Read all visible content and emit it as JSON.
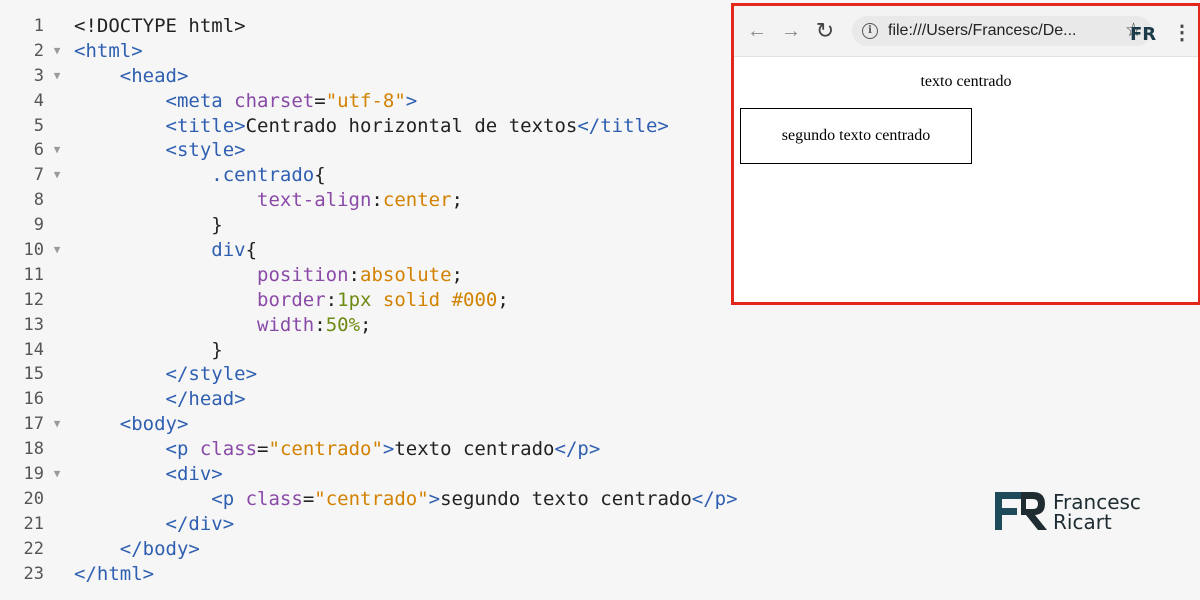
{
  "editor": {
    "lines": [
      {
        "n": "1",
        "fold": false,
        "indent": 0,
        "tokens": [
          [
            "p",
            "<!DOCTYPE html>"
          ]
        ]
      },
      {
        "n": "2",
        "fold": true,
        "indent": 0,
        "tokens": [
          [
            "t",
            "<html>"
          ]
        ]
      },
      {
        "n": "3",
        "fold": true,
        "indent": 4,
        "tokens": [
          [
            "t",
            "<head>"
          ]
        ]
      },
      {
        "n": "4",
        "fold": false,
        "indent": 8,
        "tokens": [
          [
            "t",
            "<meta "
          ],
          [
            "a",
            "charset"
          ],
          [
            "p",
            "="
          ],
          [
            "s",
            "\"utf-8\""
          ],
          [
            "t",
            ">"
          ]
        ]
      },
      {
        "n": "5",
        "fold": false,
        "indent": 8,
        "tokens": [
          [
            "t",
            "<title>"
          ],
          [
            "p",
            "Centrado horizontal de textos"
          ],
          [
            "t",
            "</title>"
          ]
        ]
      },
      {
        "n": "6",
        "fold": true,
        "indent": 8,
        "tokens": [
          [
            "t",
            "<style>"
          ]
        ]
      },
      {
        "n": "7",
        "fold": true,
        "indent": 12,
        "tokens": [
          [
            "t",
            ".centrado"
          ],
          [
            "p",
            "{"
          ]
        ]
      },
      {
        "n": "8",
        "fold": false,
        "indent": 16,
        "tokens": [
          [
            "a",
            "text-align"
          ],
          [
            "p",
            ":"
          ],
          [
            "s",
            "center"
          ],
          [
            "p",
            ";"
          ]
        ]
      },
      {
        "n": "9",
        "fold": false,
        "indent": 12,
        "tokens": [
          [
            "p",
            "}"
          ]
        ]
      },
      {
        "n": "10",
        "fold": true,
        "indent": 12,
        "tokens": [
          [
            "t",
            "div"
          ],
          [
            "p",
            "{"
          ]
        ]
      },
      {
        "n": "11",
        "fold": false,
        "indent": 16,
        "tokens": [
          [
            "a",
            "position"
          ],
          [
            "p",
            ":"
          ],
          [
            "s",
            "absolute"
          ],
          [
            "p",
            ";"
          ]
        ]
      },
      {
        "n": "12",
        "fold": false,
        "indent": 16,
        "tokens": [
          [
            "a",
            "border"
          ],
          [
            "p",
            ":"
          ],
          [
            "n",
            "1px"
          ],
          [
            "p",
            " "
          ],
          [
            "s",
            "solid"
          ],
          [
            "p",
            " "
          ],
          [
            "s",
            "#000"
          ],
          [
            "p",
            ";"
          ]
        ]
      },
      {
        "n": "13",
        "fold": false,
        "indent": 16,
        "tokens": [
          [
            "a",
            "width"
          ],
          [
            "p",
            ":"
          ],
          [
            "n",
            "50%"
          ],
          [
            "p",
            ";"
          ]
        ]
      },
      {
        "n": "14",
        "fold": false,
        "indent": 12,
        "tokens": [
          [
            "p",
            "}"
          ]
        ]
      },
      {
        "n": "15",
        "fold": false,
        "indent": 8,
        "tokens": [
          [
            "t",
            "</style>"
          ]
        ]
      },
      {
        "n": "16",
        "fold": false,
        "indent": 8,
        "tokens": [
          [
            "t",
            "</head>"
          ]
        ]
      },
      {
        "n": "17",
        "fold": true,
        "indent": 4,
        "tokens": [
          [
            "t",
            "<body>"
          ]
        ]
      },
      {
        "n": "18",
        "fold": false,
        "indent": 8,
        "tokens": [
          [
            "t",
            "<p "
          ],
          [
            "a",
            "class"
          ],
          [
            "p",
            "="
          ],
          [
            "s",
            "\"centrado\""
          ],
          [
            "t",
            ">"
          ],
          [
            "p",
            "texto centrado"
          ],
          [
            "t",
            "</p>"
          ]
        ]
      },
      {
        "n": "19",
        "fold": true,
        "indent": 8,
        "tokens": [
          [
            "t",
            "<div>"
          ]
        ]
      },
      {
        "n": "20",
        "fold": false,
        "indent": 12,
        "tokens": [
          [
            "t",
            "<p "
          ],
          [
            "a",
            "class"
          ],
          [
            "p",
            "="
          ],
          [
            "s",
            "\"centrado\""
          ],
          [
            "t",
            ">"
          ],
          [
            "p",
            "segundo texto centrado"
          ],
          [
            "t",
            "</p>"
          ]
        ]
      },
      {
        "n": "21",
        "fold": false,
        "indent": 8,
        "tokens": [
          [
            "t",
            "</div>"
          ]
        ]
      },
      {
        "n": "22",
        "fold": false,
        "indent": 4,
        "tokens": [
          [
            "t",
            "</body>"
          ]
        ]
      },
      {
        "n": "23",
        "fold": false,
        "indent": 0,
        "tokens": [
          [
            "t",
            "</html>"
          ]
        ]
      }
    ]
  },
  "browser": {
    "url": "file:///Users/Francesc/De...",
    "back_icon": "arrow-left-icon",
    "forward_icon": "arrow-right-icon",
    "reload_icon": "reload-icon",
    "ext_label": "FR",
    "paragraph_1": "texto centrado",
    "paragraph_2": "segundo texto centrado"
  },
  "logo": {
    "line1": "Francesc",
    "line2": "Ricart"
  },
  "colors": {
    "highlight_border": "#e3271b",
    "tag": "#2f5fb0",
    "attribute": "#8a4aa8",
    "string": "#d28200",
    "number": "#6d8a12"
  }
}
